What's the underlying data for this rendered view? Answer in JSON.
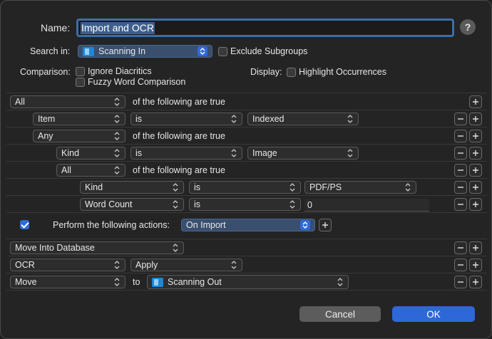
{
  "name_label": "Name:",
  "name_value": "Import and OCR",
  "help_label": "?",
  "search_in_label": "Search in:",
  "search_in_value": "Scanning In",
  "exclude_subgroups_label": "Exclude Subgroups",
  "comparison_label": "Comparison:",
  "ignore_diacritics_label": "Ignore Diacritics",
  "fuzzy_label": "Fuzzy Word Comparison",
  "display_label": "Display:",
  "highlight_label": "Highlight Occurrences",
  "criteria": {
    "r0": {
      "match": "All",
      "text": "of the following are true"
    },
    "r1": {
      "field": "Item",
      "op": "is",
      "value": "Indexed"
    },
    "r2": {
      "match": "Any",
      "text": "of the following are true"
    },
    "r3": {
      "field": "Kind",
      "op": "is",
      "value": "Image"
    },
    "r4": {
      "match": "All",
      "text": "of the following are true"
    },
    "r5": {
      "field": "Kind",
      "op": "is",
      "value": "PDF/PS"
    },
    "r6": {
      "field": "Word Count",
      "op": "is",
      "value": "0"
    }
  },
  "perform_label": "Perform the following actions:",
  "perform_checked": true,
  "perform_value": "On Import",
  "actions": {
    "a0": {
      "action": "Move Into Database"
    },
    "a1": {
      "action": "OCR",
      "param": "Apply"
    },
    "a2": {
      "action": "Move",
      "to": "to",
      "dest": "Scanning Out"
    }
  },
  "cancel_label": "Cancel",
  "ok_label": "OK",
  "colors": {
    "accent": "#2e68d8",
    "background": "#242424"
  }
}
